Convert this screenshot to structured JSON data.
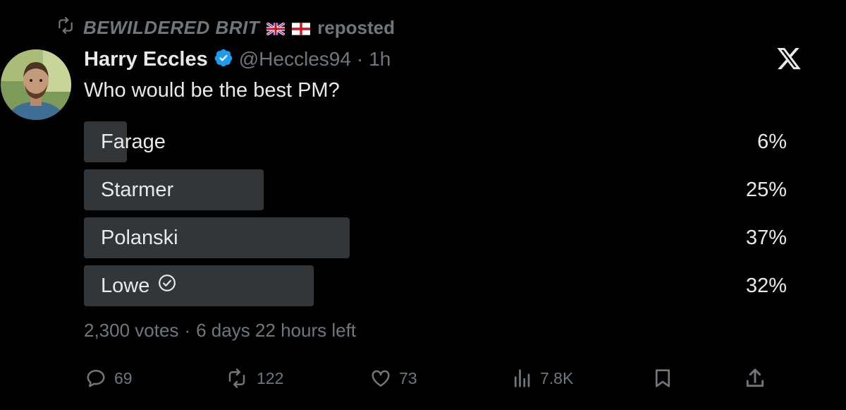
{
  "repost": {
    "name": "BEWILDERED BRIT",
    "label": "reposted",
    "flags": [
      "uk-flag",
      "england-flag"
    ]
  },
  "tweet": {
    "display_name": "Harry Eccles",
    "handle": "@Heccles94",
    "separator": "·",
    "time": "1h",
    "question": "Who would be the best PM?"
  },
  "poll": {
    "options": [
      {
        "label": "Farage",
        "percent": 6,
        "percent_text": "6%",
        "selected": false
      },
      {
        "label": "Starmer",
        "percent": 25,
        "percent_text": "25%",
        "selected": false
      },
      {
        "label": "Polanski",
        "percent": 37,
        "percent_text": "37%",
        "selected": false
      },
      {
        "label": "Lowe",
        "percent": 32,
        "percent_text": "32%",
        "selected": true
      }
    ],
    "votes": "2,300 votes",
    "separator": "·",
    "time_left": "6 days 22 hours left"
  },
  "actions": {
    "replies": "69",
    "reposts": "122",
    "likes": "73",
    "views": "7.8K"
  },
  "colors": {
    "background": "#000000",
    "text": "#e7e9ea",
    "muted": "#71767b",
    "poll_bar": "#333639",
    "verified": "#1d9bf0"
  },
  "icons": [
    "repost-icon",
    "verified-badge-icon",
    "x-logo-icon",
    "check-circle-icon",
    "reply-icon",
    "like-icon",
    "views-icon",
    "bookmark-icon",
    "share-icon"
  ]
}
